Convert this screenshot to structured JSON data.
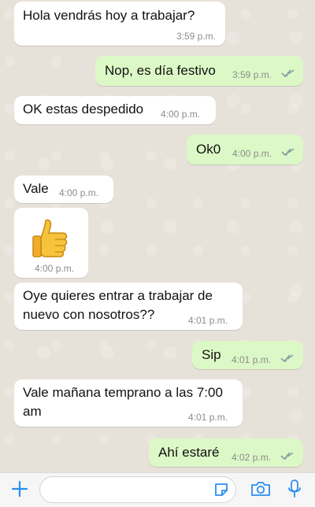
{
  "messages": [
    {
      "text": "Hola vendrás hoy a trabajar?",
      "time": "3:59 p.m."
    },
    {
      "text": "Nop, es día festivo",
      "time": "3:59 p.m."
    },
    {
      "text": "OK estas despedido",
      "time": "4:00 p.m."
    },
    {
      "text": "Ok0",
      "time": "4:00 p.m."
    },
    {
      "text": "Vale",
      "time": "4:00 p.m."
    },
    {
      "emoji": "thumbs-up",
      "time": "4:00 p.m."
    },
    {
      "line1": "Oye quieres entrar a trabajar de",
      "line2": "nuevo con nosotros??",
      "time": "4:01 p.m."
    },
    {
      "text": "Sip",
      "time": "4:01 p.m."
    },
    {
      "line1": "Vale mañana temprano a las 7:00",
      "line2": "am",
      "time": "4:01 p.m."
    },
    {
      "text": "Ahí estaré",
      "time": "4:02 p.m."
    }
  ],
  "composer": {
    "placeholder": "",
    "icons": [
      "plus-icon",
      "sticker-icon",
      "camera-icon",
      "microphone-icon"
    ]
  },
  "colors": {
    "incoming": "#ffffff",
    "outgoing": "#dcf8c6",
    "accent": "#2a8ef0",
    "read_ticks": "#8a9aa3"
  }
}
